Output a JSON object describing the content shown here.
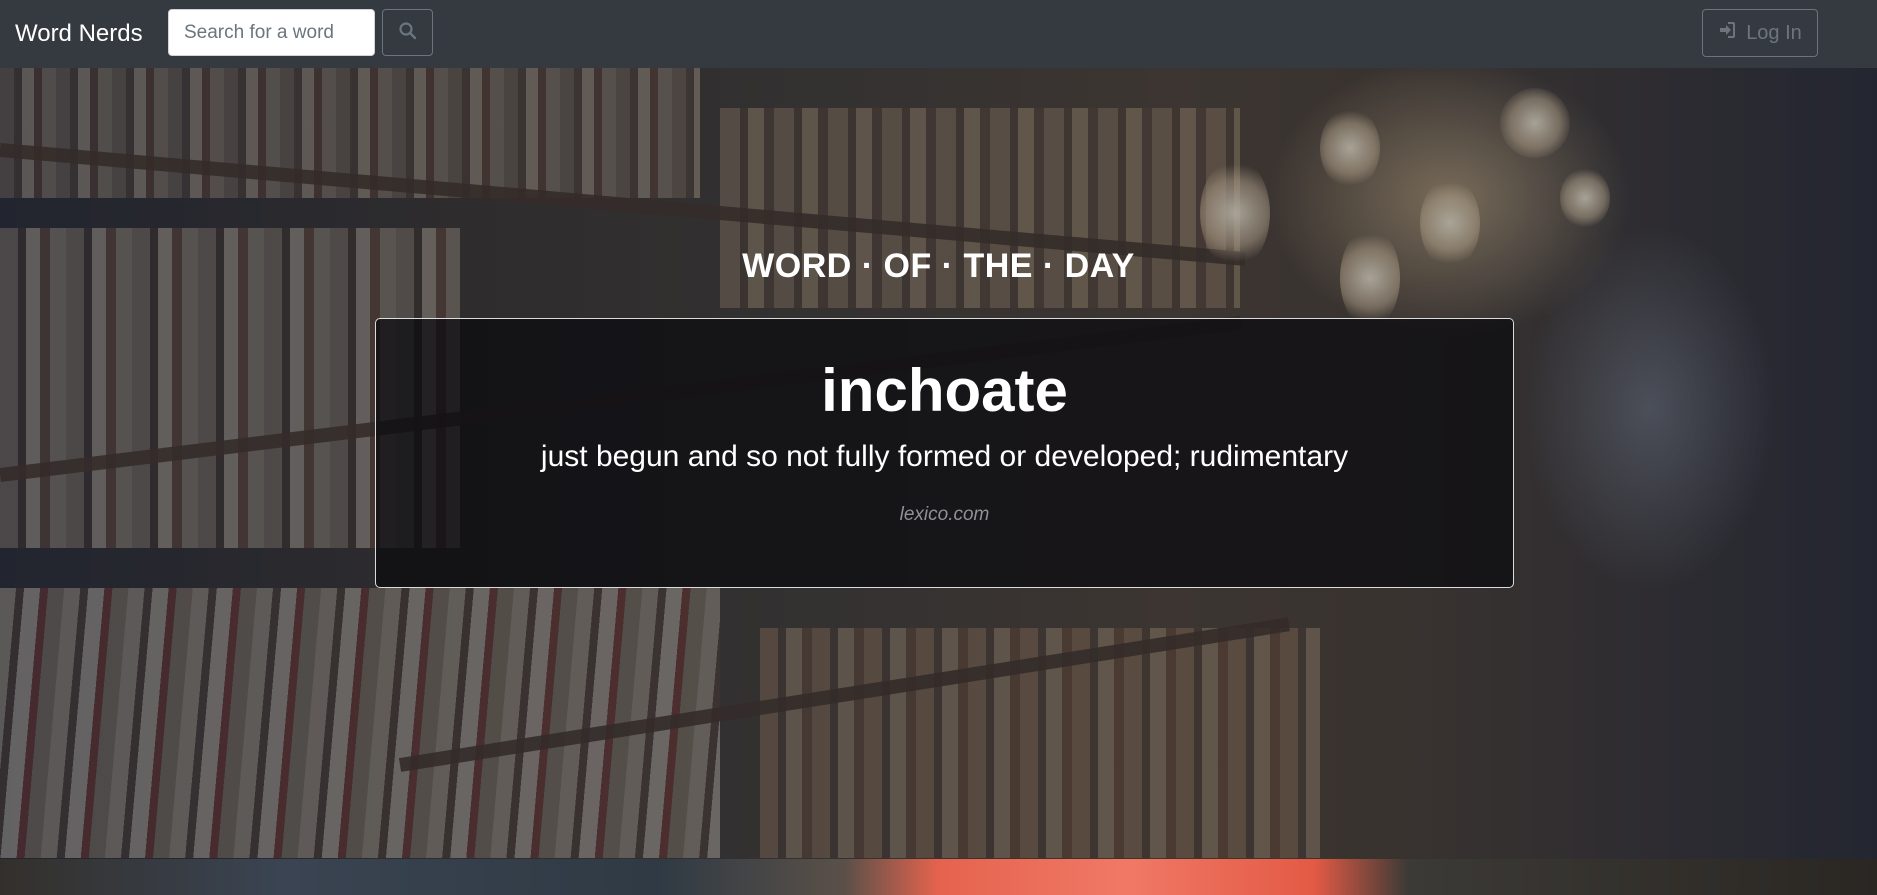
{
  "nav": {
    "brand": "Word Nerds",
    "search_placeholder": "Search for a word",
    "search_icon": "search-icon",
    "login_label": "Log In",
    "login_icon": "sign-in-icon"
  },
  "word_of_the_day": {
    "heading": "WORD · OF · THE · DAY",
    "word": "inchoate",
    "definition": "just begun and so not fully formed or developed; rudimentary",
    "source": "lexico.com"
  },
  "colors": {
    "navbar": "#343a40",
    "muted": "#6c757d",
    "card_bg": "rgba(10,10,14,0.72)",
    "text": "#ffffff"
  }
}
